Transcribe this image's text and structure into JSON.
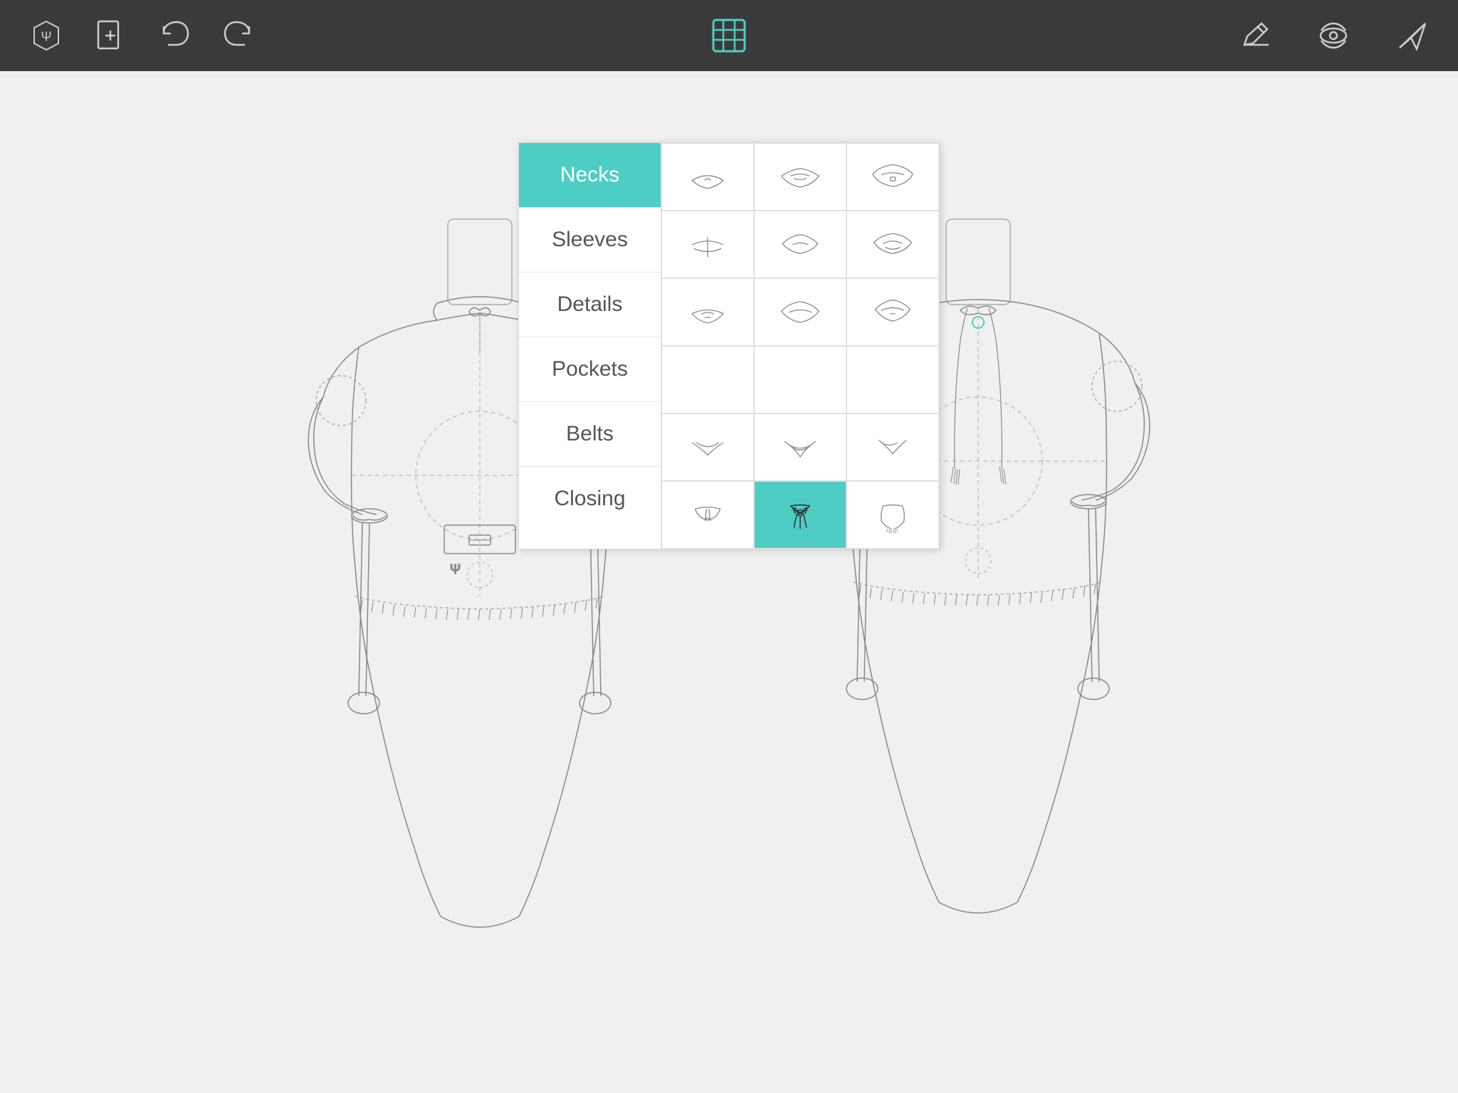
{
  "toolbar": {
    "logo_label": "Ψ",
    "new_label": "+",
    "undo_label": "↩",
    "redo_label": "↪",
    "list_label": "≡",
    "edit_label": "✎",
    "preview_label": "👁",
    "send_label": "✈"
  },
  "panel": {
    "categories": [
      {
        "id": "necks",
        "label": "Necks",
        "active": true
      },
      {
        "id": "sleeves",
        "label": "Sleeves",
        "active": false
      },
      {
        "id": "details",
        "label": "Details",
        "active": false
      },
      {
        "id": "pockets",
        "label": "Pockets",
        "active": false
      },
      {
        "id": "belts",
        "label": "Belts",
        "active": false
      },
      {
        "id": "closing",
        "label": "Closing",
        "active": false
      }
    ],
    "selected_row": 5,
    "selected_col": 1
  },
  "colors": {
    "accent": "#4ecdc4",
    "toolbar_bg": "#3a3a3a",
    "border": "#e0e0e0"
  }
}
